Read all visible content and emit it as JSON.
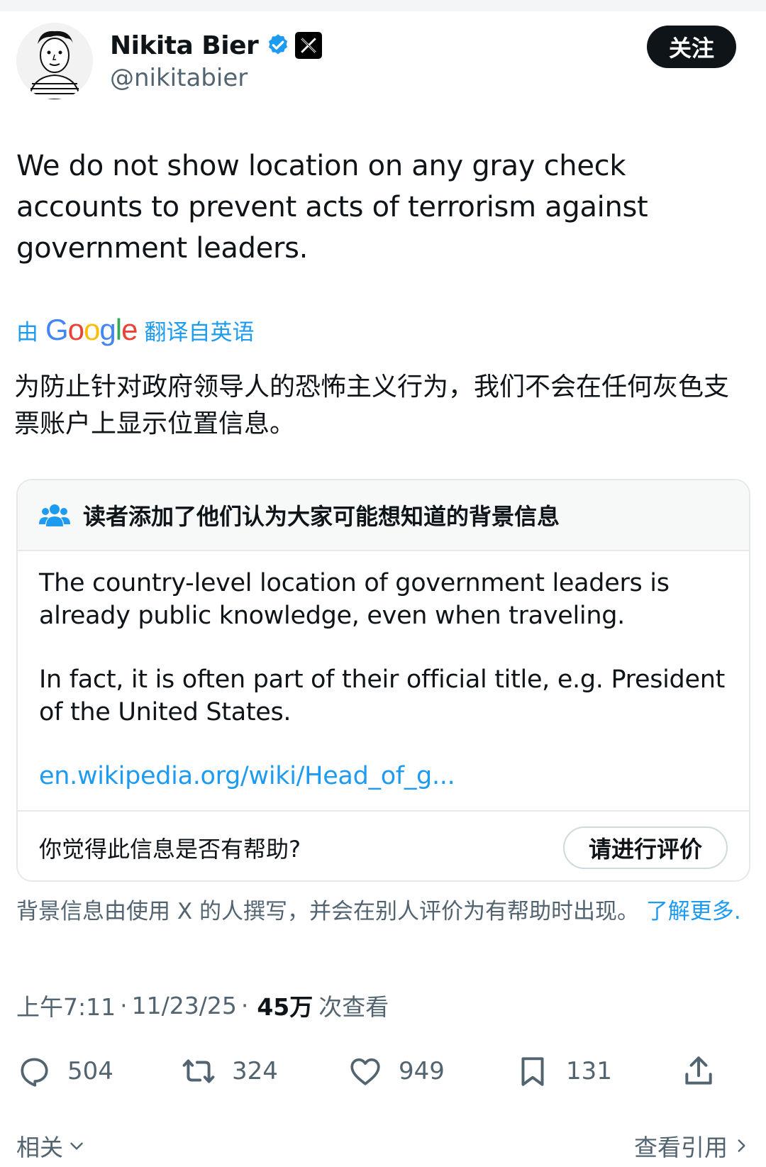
{
  "author": {
    "display_name": "Nikita Bier",
    "handle": "@nikitabier"
  },
  "follow_label": "关注",
  "tweet_text": "We do not show location on any gray check accounts to prevent acts of terrorism against government leaders.",
  "translation": {
    "prefix": "由",
    "provider": "Google",
    "suffix": "翻译自英语",
    "text": "为防止针对政府领导人的恐怖主义行为，我们不会在任何灰色支票账户上显示位置信息。"
  },
  "community_note": {
    "title": "读者添加了他们认为大家可能想知道的背景信息",
    "paragraph_1": "The country-level location of government leaders is already public knowledge, even when traveling.",
    "paragraph_2": "In fact, it is often part of their official title, e.g. President of the United States.",
    "link": "en.wikipedia.org/wiki/Head_of_g...",
    "helpful_question": "你觉得此信息是否有帮助?",
    "rate_label": "请进行评价"
  },
  "disclaimer": {
    "text": "背景信息由使用 X 的人撰写，并会在别人评价为有帮助时出现。",
    "learn_more": "了解更多",
    "end": "."
  },
  "meta": {
    "time": "上午7:11",
    "sep1": "·",
    "date": "11/23/25",
    "sep2": "·",
    "views": "45万",
    "views_label": "次查看"
  },
  "actions": {
    "replies": "504",
    "reposts": "324",
    "likes": "949",
    "bookmarks": "131"
  },
  "bottom": {
    "related": "相关",
    "view_quotes": "查看引用"
  },
  "colors": {
    "accent": "#1d9bf0",
    "verified": "#1d9bf0",
    "text": "#0f1419",
    "secondary": "#536471"
  },
  "icons": [
    "verified-badge-icon",
    "x-logo-icon",
    "people-icon",
    "reply-icon",
    "repost-icon",
    "like-icon",
    "bookmark-icon",
    "share-icon",
    "chevron-down-icon",
    "chevron-right-icon"
  ]
}
